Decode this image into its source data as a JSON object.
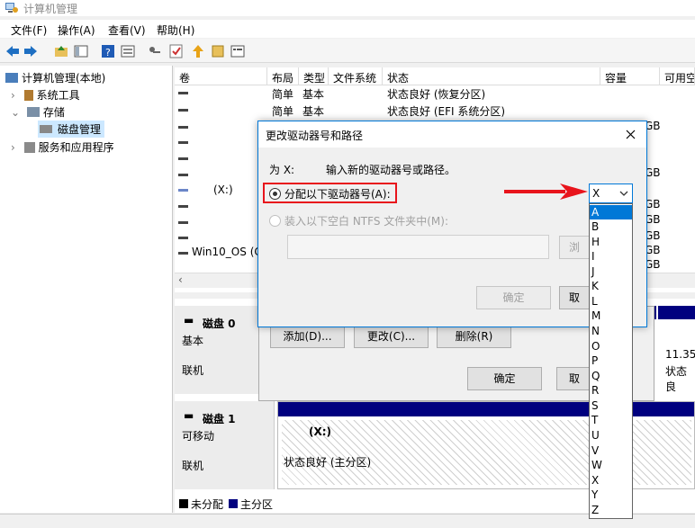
{
  "window": {
    "title": "计算机管理"
  },
  "menu": [
    "文件(F)",
    "操作(A)",
    "查看(V)",
    "帮助(H)"
  ],
  "toolbar_icons": [
    "back-arrow-icon",
    "forward-arrow-icon",
    "up-folder-icon",
    "show-tree-icon",
    "help-icon",
    "properties-icon",
    "key-icon",
    "check-icon",
    "arrow-up-icon",
    "stop-icon"
  ],
  "tree": {
    "root": "计算机管理(本地)",
    "system_tools": "系统工具",
    "storage": "存储",
    "disk_mgmt": "磁盘管理",
    "services": "服务和应用程序"
  },
  "columns": [
    "卷",
    "布局",
    "类型",
    "文件系统",
    "状态",
    "容量",
    "可用空"
  ],
  "rows": [
    {
      "vol": "",
      "layout": "简单",
      "type": "基本",
      "fs": "",
      "status": "状态良好 (恢复分区)",
      "cap": ""
    },
    {
      "vol": "",
      "layout": "简单",
      "type": "基本",
      "fs": "",
      "status": "状态良好 (EFI 系统分区)",
      "cap": ""
    },
    {
      "vol": "",
      "cap": "GB"
    },
    {
      "vol": "",
      "cap": ""
    },
    {
      "vol": "",
      "cap": "GB"
    },
    {
      "vol": "(X:)",
      "cap": "GB"
    },
    {
      "vol": "",
      "cap": "GB"
    },
    {
      "vol": "",
      "cap": "GB"
    },
    {
      "vol": "",
      "cap": "GB"
    },
    {
      "vol": "Win10_OS (C",
      "cap": "GB"
    }
  ],
  "disk0": {
    "name": "磁盘 0",
    "type": "基本",
    "status": "联机",
    "part_right_size": "11.35",
    "part_right_status": "状态良",
    "part_mid_frag1": "d",
    "part_mid_frag2": "S",
    "part_mid_frag3": "E"
  },
  "disk1": {
    "name": "磁盘 1",
    "type": "可移动",
    "status": "联机",
    "part_letter": "(X:)",
    "part_status": "状态良好 (主分区)"
  },
  "legend": {
    "unalloc": "未分配",
    "primary": "主分区"
  },
  "parent_dialog": {
    "add": "添加(D)...",
    "change": "更改(C)...",
    "remove": "删除(R)",
    "ok": "确定",
    "cancel_frag": "取"
  },
  "dialog": {
    "title": "更改驱动器号和路径",
    "for_label": "为 X:",
    "prompt": "输入新的驱动器号或路径。",
    "assign_label": "分配以下驱动器号(A):",
    "mount_label": "装入以下空白 NTFS 文件夹中(M):",
    "path_value": "",
    "browse_frag": "浏",
    "ok": "确定",
    "cancel_frag": "取"
  },
  "combo": {
    "selected": "X"
  },
  "letters": [
    "A",
    "B",
    "H",
    "I",
    "J",
    "K",
    "L",
    "M",
    "N",
    "O",
    "P",
    "Q",
    "R",
    "S",
    "T",
    "U",
    "V",
    "W",
    "X",
    "Y",
    "Z"
  ],
  "colors": {
    "accent": "#0078d7",
    "highlight": "#e8141c",
    "primary_partition": "#00007f"
  }
}
